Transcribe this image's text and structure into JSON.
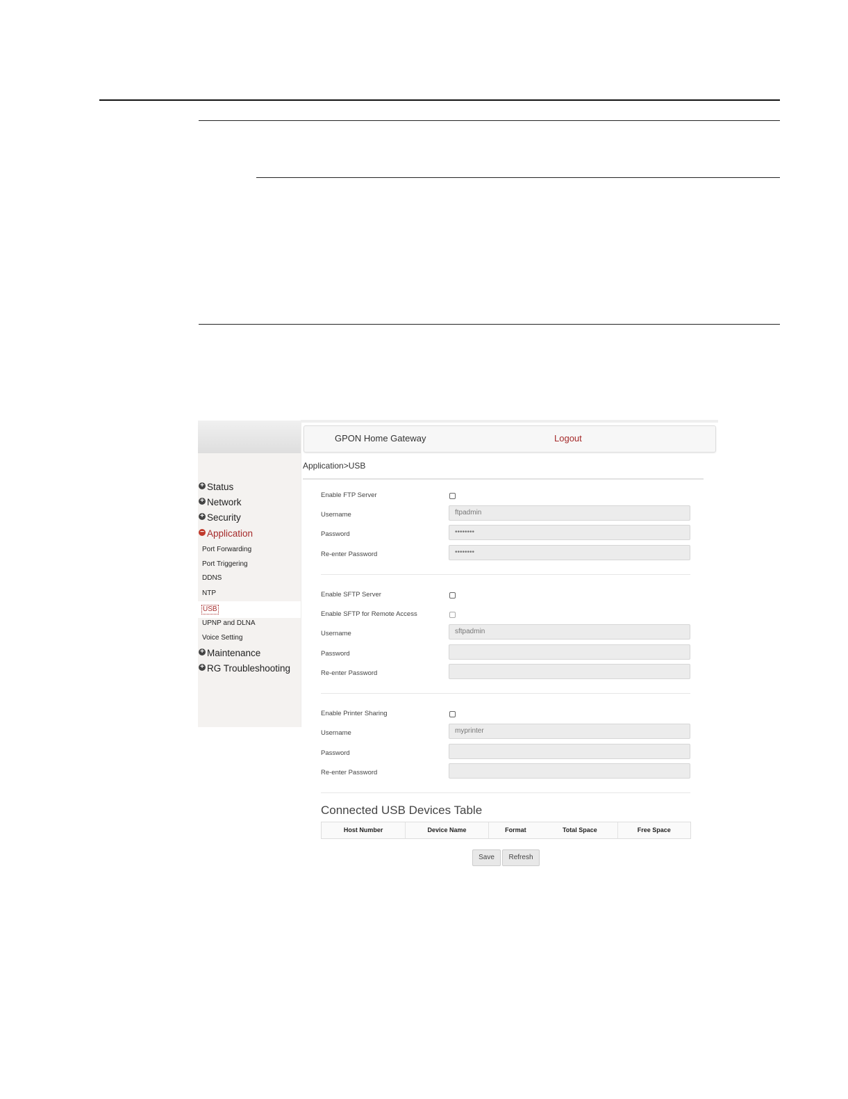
{
  "header": {
    "title": "GPON Home Gateway",
    "logout": "Logout"
  },
  "breadcrumb": "Application>USB",
  "sidebar": {
    "top_items": [
      {
        "label": "Status",
        "expanded": false
      },
      {
        "label": "Network",
        "expanded": false
      },
      {
        "label": "Security",
        "expanded": false
      },
      {
        "label": "Application",
        "expanded": true
      },
      {
        "label": "Maintenance",
        "expanded": false
      },
      {
        "label": "RG Troubleshooting",
        "expanded": false
      }
    ],
    "application_items": [
      "Port Forwarding",
      "Port Triggering",
      "DDNS",
      "NTP",
      "USB",
      "UPNP and DLNA",
      "Voice Setting"
    ],
    "current": "USB"
  },
  "ftp": {
    "enable_label": "Enable FTP Server",
    "enabled": false,
    "username_label": "Username",
    "username_value": "ftpadmin",
    "password_label": "Password",
    "password_value": "••••••••",
    "reenter_label": "Re-enter Password",
    "reenter_value": "••••••••"
  },
  "sftp": {
    "enable_label": "Enable SFTP Server",
    "enabled": false,
    "remote_label": "Enable SFTP for Remote Access",
    "remote_enabled": false,
    "username_label": "Username",
    "username_value": "sftpadmin",
    "password_label": "Password",
    "password_value": "",
    "reenter_label": "Re-enter Password",
    "reenter_value": ""
  },
  "printer": {
    "enable_label": "Enable Printer Sharing",
    "enabled": false,
    "username_label": "Username",
    "username_value": "myprinter",
    "password_label": "Password",
    "password_value": "",
    "reenter_label": "Re-enter Password",
    "reenter_value": ""
  },
  "usb_table": {
    "title": "Connected USB Devices Table",
    "columns": [
      "Host Number",
      "Device Name",
      "Format",
      "Total Space",
      "Free Space"
    ],
    "rows": []
  },
  "buttons": {
    "save": "Save",
    "refresh": "Refresh"
  },
  "colors": {
    "accent": "#a52a2a",
    "sidebar_bg": "#f4f2f0",
    "field_bg": "#ececec"
  }
}
